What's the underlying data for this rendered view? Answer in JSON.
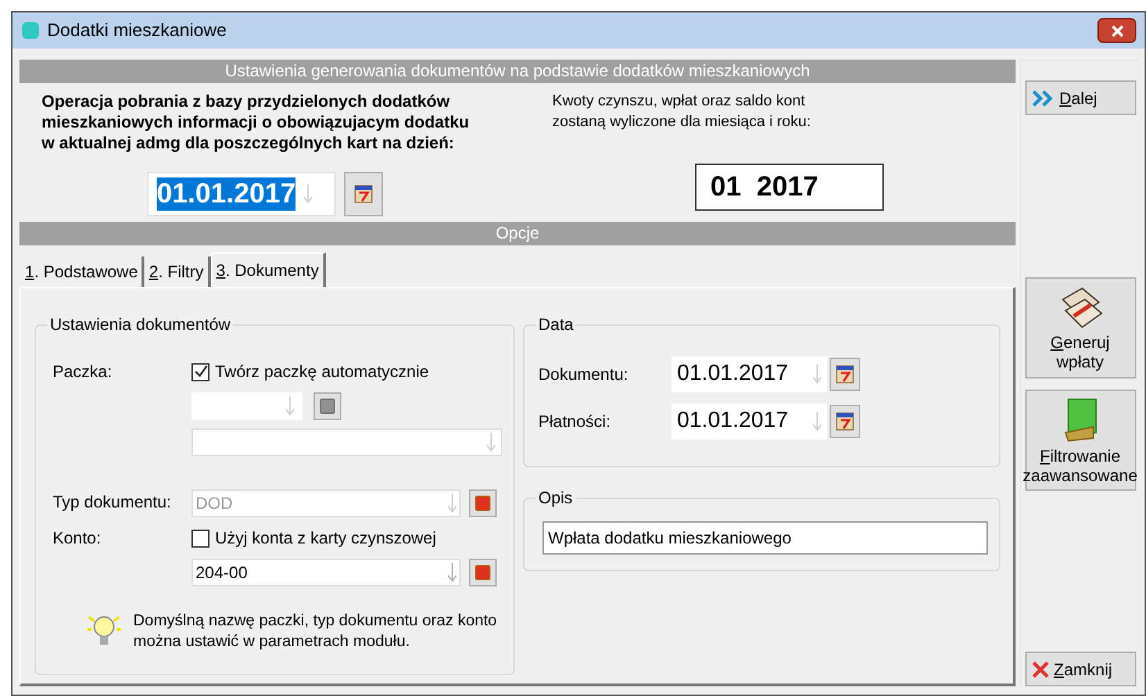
{
  "window": {
    "title": "Dodatki mieszkaniowe"
  },
  "header": "Ustawienia generowania dokumentów na podstawie dodatków mieszkaniowych",
  "operation_text": [
    "Operacja pobrania z bazy przydzielonych dodatków",
    "mieszkaniowych informacji o obowiązujacym dodatku",
    "w aktualnej admg dla poszczególnych kart na dzień:"
  ],
  "operation_date": {
    "value": "01.01.2017",
    "selected": true
  },
  "amounts_text": [
    "Kwoty czynszu, wpłat oraz saldo kont",
    "zostaną wyliczone dla miesiąca i roku:"
  ],
  "period": "01  2017",
  "options_header": "Opcje",
  "tabs": [
    {
      "label": "1. Podstawowe",
      "selected": false
    },
    {
      "label": "2. Filtry",
      "selected": false
    },
    {
      "label": "3. Dokumenty",
      "selected": true
    }
  ],
  "documents": {
    "title": "Ustawienia dokumentów",
    "package_label": "Paczka:",
    "auto_package": {
      "label": "Twórz paczkę automatycznie",
      "checked": true
    },
    "doc_type_label": "Typ dokumentu:",
    "doc_type": {
      "value": "DOD",
      "disabled": true
    },
    "account_label": "Konto:",
    "use_account": {
      "label": "Użyj konta z karty czynszowej",
      "checked": false
    },
    "account": "204-00",
    "hint": [
      "Domyślną nazwę paczki, typ dokumentu oraz konto",
      "można ustawić w parametrach modułu."
    ]
  },
  "dates": {
    "title": "Data",
    "rows": [
      {
        "label": "Dokumentu:",
        "value": "01.01.2017"
      },
      {
        "label": "Płatności:",
        "value": "01.01.2017"
      }
    ]
  },
  "description": {
    "title": "Opis",
    "value": "Wpłata dodatku mieszkaniowego"
  },
  "side_buttons": [
    {
      "kind": "next",
      "label": "Dalej"
    },
    {
      "kind": "generate",
      "label": "Generuj wpłaty"
    },
    {
      "kind": "filter",
      "label": "Filtrowanie zaawansowane"
    },
    {
      "kind": "close",
      "label": "Zamknij"
    }
  ]
}
